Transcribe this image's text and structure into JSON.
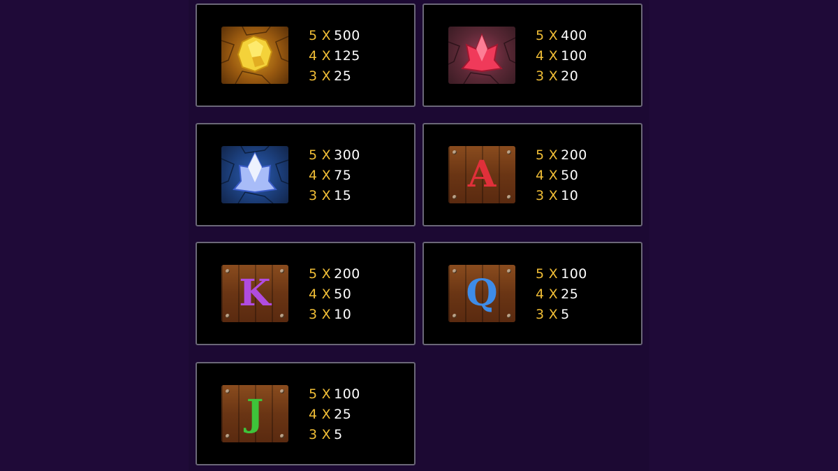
{
  "paytable": [
    {
      "symbol": "gold-crystal",
      "pays": [
        {
          "count": "5",
          "value": "500"
        },
        {
          "count": "4",
          "value": "125"
        },
        {
          "count": "3",
          "value": "25"
        }
      ]
    },
    {
      "symbol": "red-crystal",
      "pays": [
        {
          "count": "5",
          "value": "400"
        },
        {
          "count": "4",
          "value": "100"
        },
        {
          "count": "3",
          "value": "20"
        }
      ]
    },
    {
      "symbol": "blue-crystal",
      "pays": [
        {
          "count": "5",
          "value": "300"
        },
        {
          "count": "4",
          "value": "75"
        },
        {
          "count": "3",
          "value": "15"
        }
      ]
    },
    {
      "symbol": "letter-a",
      "letter": "A",
      "letter_color": "#e0303a",
      "pays": [
        {
          "count": "5",
          "value": "200"
        },
        {
          "count": "4",
          "value": "50"
        },
        {
          "count": "3",
          "value": "10"
        }
      ]
    },
    {
      "symbol": "letter-k",
      "letter": "K",
      "letter_color": "#b04ce0",
      "pays": [
        {
          "count": "5",
          "value": "200"
        },
        {
          "count": "4",
          "value": "50"
        },
        {
          "count": "3",
          "value": "10"
        }
      ]
    },
    {
      "symbol": "letter-q",
      "letter": "Q",
      "letter_color": "#3e8ce8",
      "pays": [
        {
          "count": "5",
          "value": "100"
        },
        {
          "count": "4",
          "value": "25"
        },
        {
          "count": "3",
          "value": "5"
        }
      ]
    },
    {
      "symbol": "letter-j",
      "letter": "J",
      "letter_color": "#3ec43a",
      "pays": [
        {
          "count": "5",
          "value": "100"
        },
        {
          "count": "4",
          "value": "25"
        },
        {
          "count": "3",
          "value": "5"
        }
      ]
    }
  ],
  "multiplier_sign": "X",
  "colors": {
    "background": "#1f0a38",
    "card": "#000000",
    "card_border": "#6b6878",
    "count": "#f1be36",
    "value": "#ffffff"
  }
}
